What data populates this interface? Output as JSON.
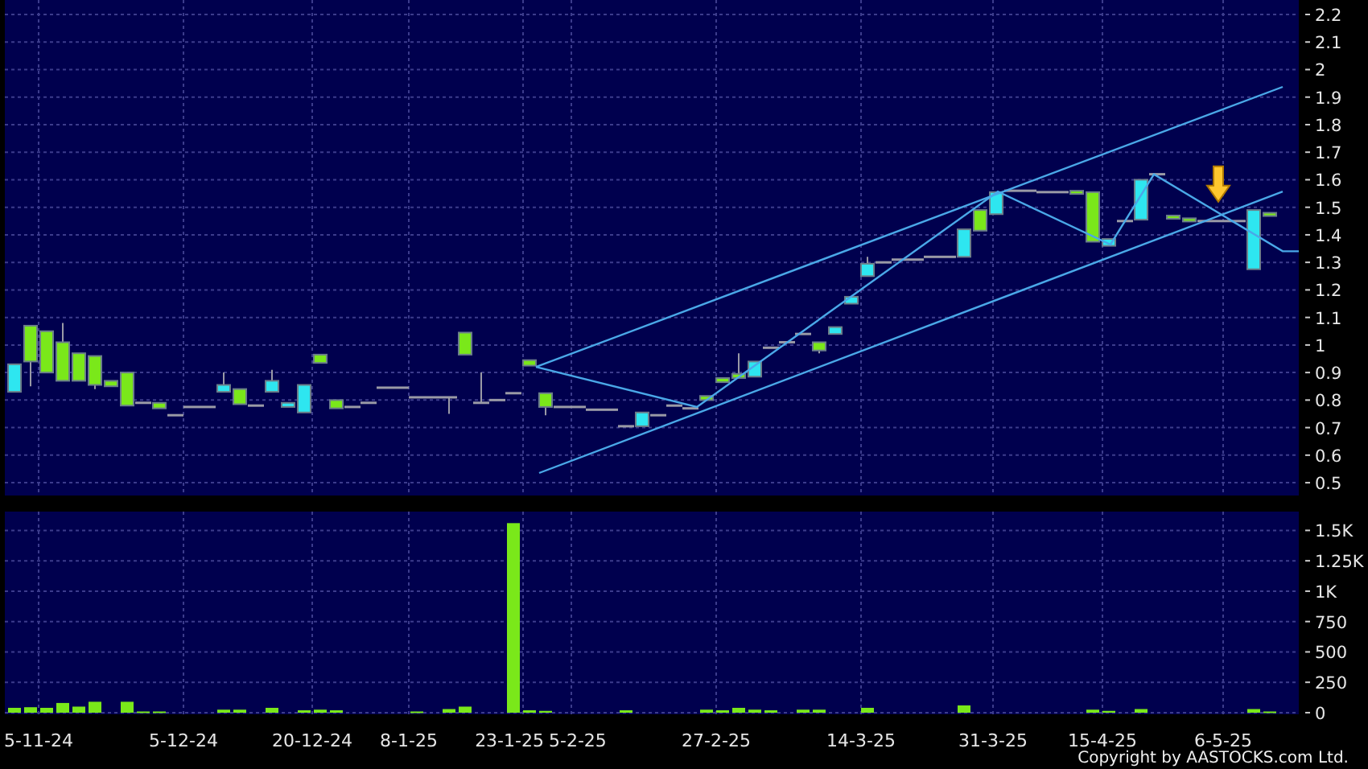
{
  "price_chart": {
    "axis_labels": [
      "2.2",
      "2.1",
      "2",
      "1.9",
      "1.8",
      "1.7",
      "1.6",
      "1.5",
      "1.4",
      "1.3",
      "1.2",
      "1.1",
      "1",
      "0.9",
      "0.8",
      "0.7",
      "0.6",
      "0.5"
    ]
  },
  "volume_chart": {
    "axis_labels": [
      "1.5K",
      "1.25K",
      "1K",
      "750",
      "500",
      "250",
      "0"
    ]
  },
  "date_labels": [
    "5-11-24",
    "5-12-24",
    "20-12-24",
    "8-1-25",
    "23-1-25",
    "5-2-25",
    "27-2-25",
    "14-3-25",
    "31-3-25",
    "15-4-25",
    "6-5-25"
  ],
  "copyright": "Copyright by AASTOCKS.com Ltd."
}
